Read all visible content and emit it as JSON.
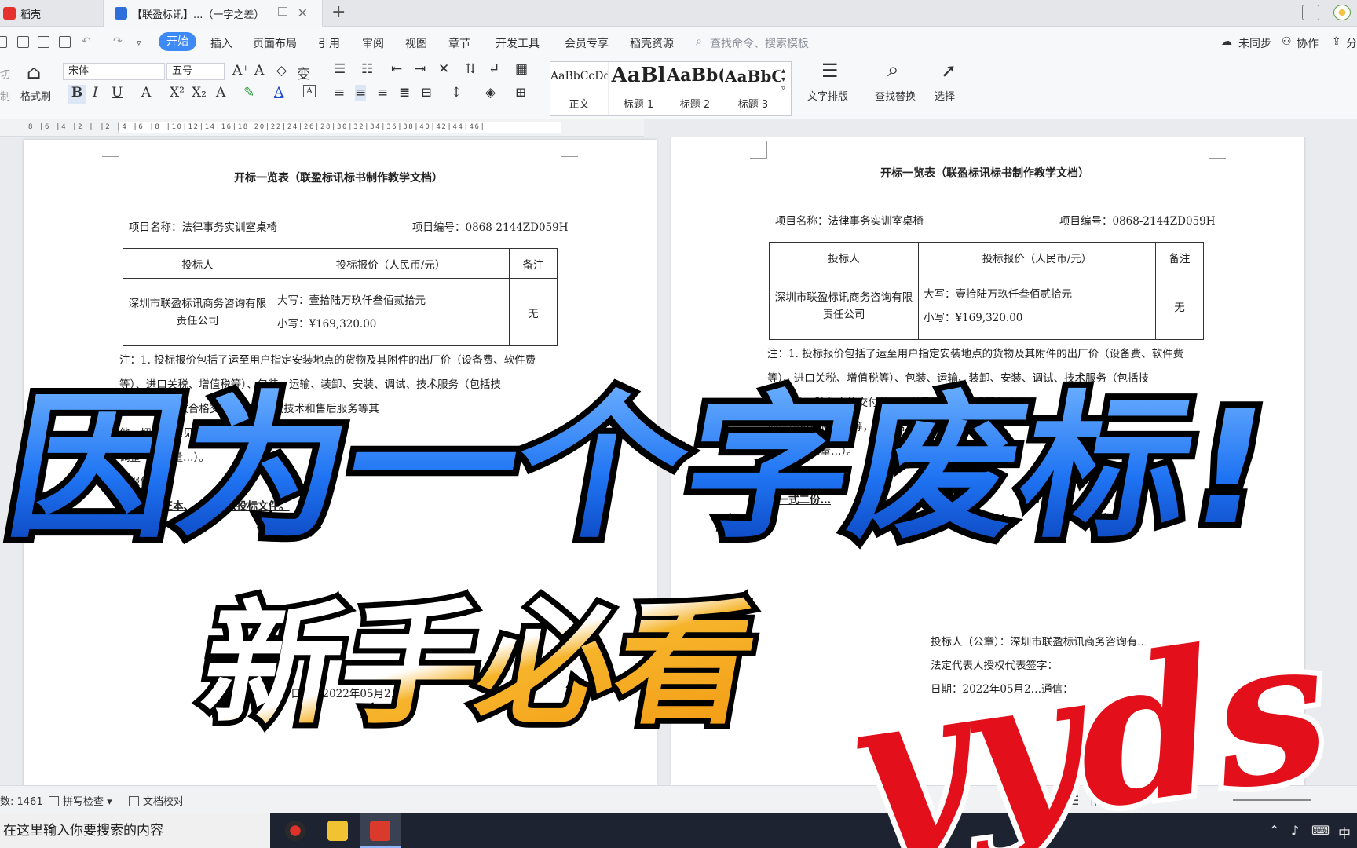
{
  "titlebar": {
    "tab1_label": "稻壳",
    "tab2_label": "【联盈标讯】...（一字之差）"
  },
  "menubar": {
    "start": "开始",
    "items": [
      "插入",
      "页面布局",
      "引用",
      "审阅",
      "视图",
      "章节",
      "开发工具",
      "会员专享",
      "稻壳资源"
    ],
    "search_placeholder": "查找命令、搜索模板",
    "sync": "未同步",
    "collab": "协作",
    "share": "分"
  },
  "ribbon": {
    "cut": "切",
    "copy": "制",
    "format_painter": "格式刷",
    "font": "宋体",
    "size": "五号",
    "styles": [
      {
        "preview": "AaBbCcDd",
        "name": "正文"
      },
      {
        "preview": "AaBl",
        "name": "标题 1"
      },
      {
        "preview": "AaBb(",
        "name": "标题 2"
      },
      {
        "preview": "AaBbC",
        "name": "标题 3"
      }
    ],
    "text_layout": "文字排版",
    "find_replace": "查找替换",
    "select": "选择"
  },
  "ruler": {
    "numbers": "8 |6 |4 |2 |  |2 |4 |6 |8 |10|12|14|16|18|20|22|24|26|28|30|32|34|36|38|40|42|44|46|"
  },
  "doc": {
    "title": "开标一览表（联盈标讯标书制作教学文档）",
    "project_name": "项目名称：法律事务实训室桌椅",
    "project_no": "项目编号：0868-2144ZD059H",
    "table": {
      "headers": [
        "投标人",
        "投标报价（人民币/元）",
        "备注"
      ],
      "bidder": "深圳市联盈标讯商务咨询有限责任公司",
      "price_upper": "大写：壹拾陆万玖仟叁佰贰拾元",
      "price_lower": "小写：¥169,320.00",
      "remark": "无"
    },
    "note_a": [
      "注：1. 投标报价包括了运至用户指定安装地点的货物及其附件的出厂价（设备费、软件费",
      "等）、进口关税、增值税等）、包装、运输、装卸、安装、调试、技术服务（包括技",
      "术培训）、验收合格交付使用之前及技术和售后服务等其",
      "他一切不可预见费等，项目结算时不作",
      "调整（因数量…）。",
      "2.报保留…",
      "3.投标…正本、一份编入投标文件。"
    ],
    "note_b": [
      "注：1. 投标报价包括了运至用户指定安装地点的货物及其附件的出厂价（设备费、软件费",
      "等）、进口关税、增值税等）、包装、运输、装卸、安装、调试、技术服务（包括技",
      "术培训）、验收合格交付使用之前及技术和售后服务等其",
      "他一切不可预见费等，项目结算时不作",
      "调整（因数量…）。",
      "…",
      "…一式二份…"
    ],
    "sig_a": [
      "权代…",
      "日期：2022年05月2…"
    ],
    "sig_b": [
      "投标人（公章）：深圳市联盈标讯商务咨询有…",
      "法定代表人授权代表签字：",
      "日期：2022年05月2…通信："
    ]
  },
  "overlay": {
    "headline": "因为一个字废标!",
    "sub": "新手必看",
    "tag": "yyds"
  },
  "status": {
    "word_count": "数: 1461",
    "spell_check": "拼写检查",
    "doc_proof": "文档校对"
  },
  "taskbar": {
    "search_placeholder": "在这里输入你要搜索的内容",
    "ime": "中"
  },
  "colors": {
    "accent": "#3d8af7",
    "headline_blue": "#1b6ef2",
    "sub_orange": "#f5a623",
    "tag_red": "#e3101b"
  }
}
